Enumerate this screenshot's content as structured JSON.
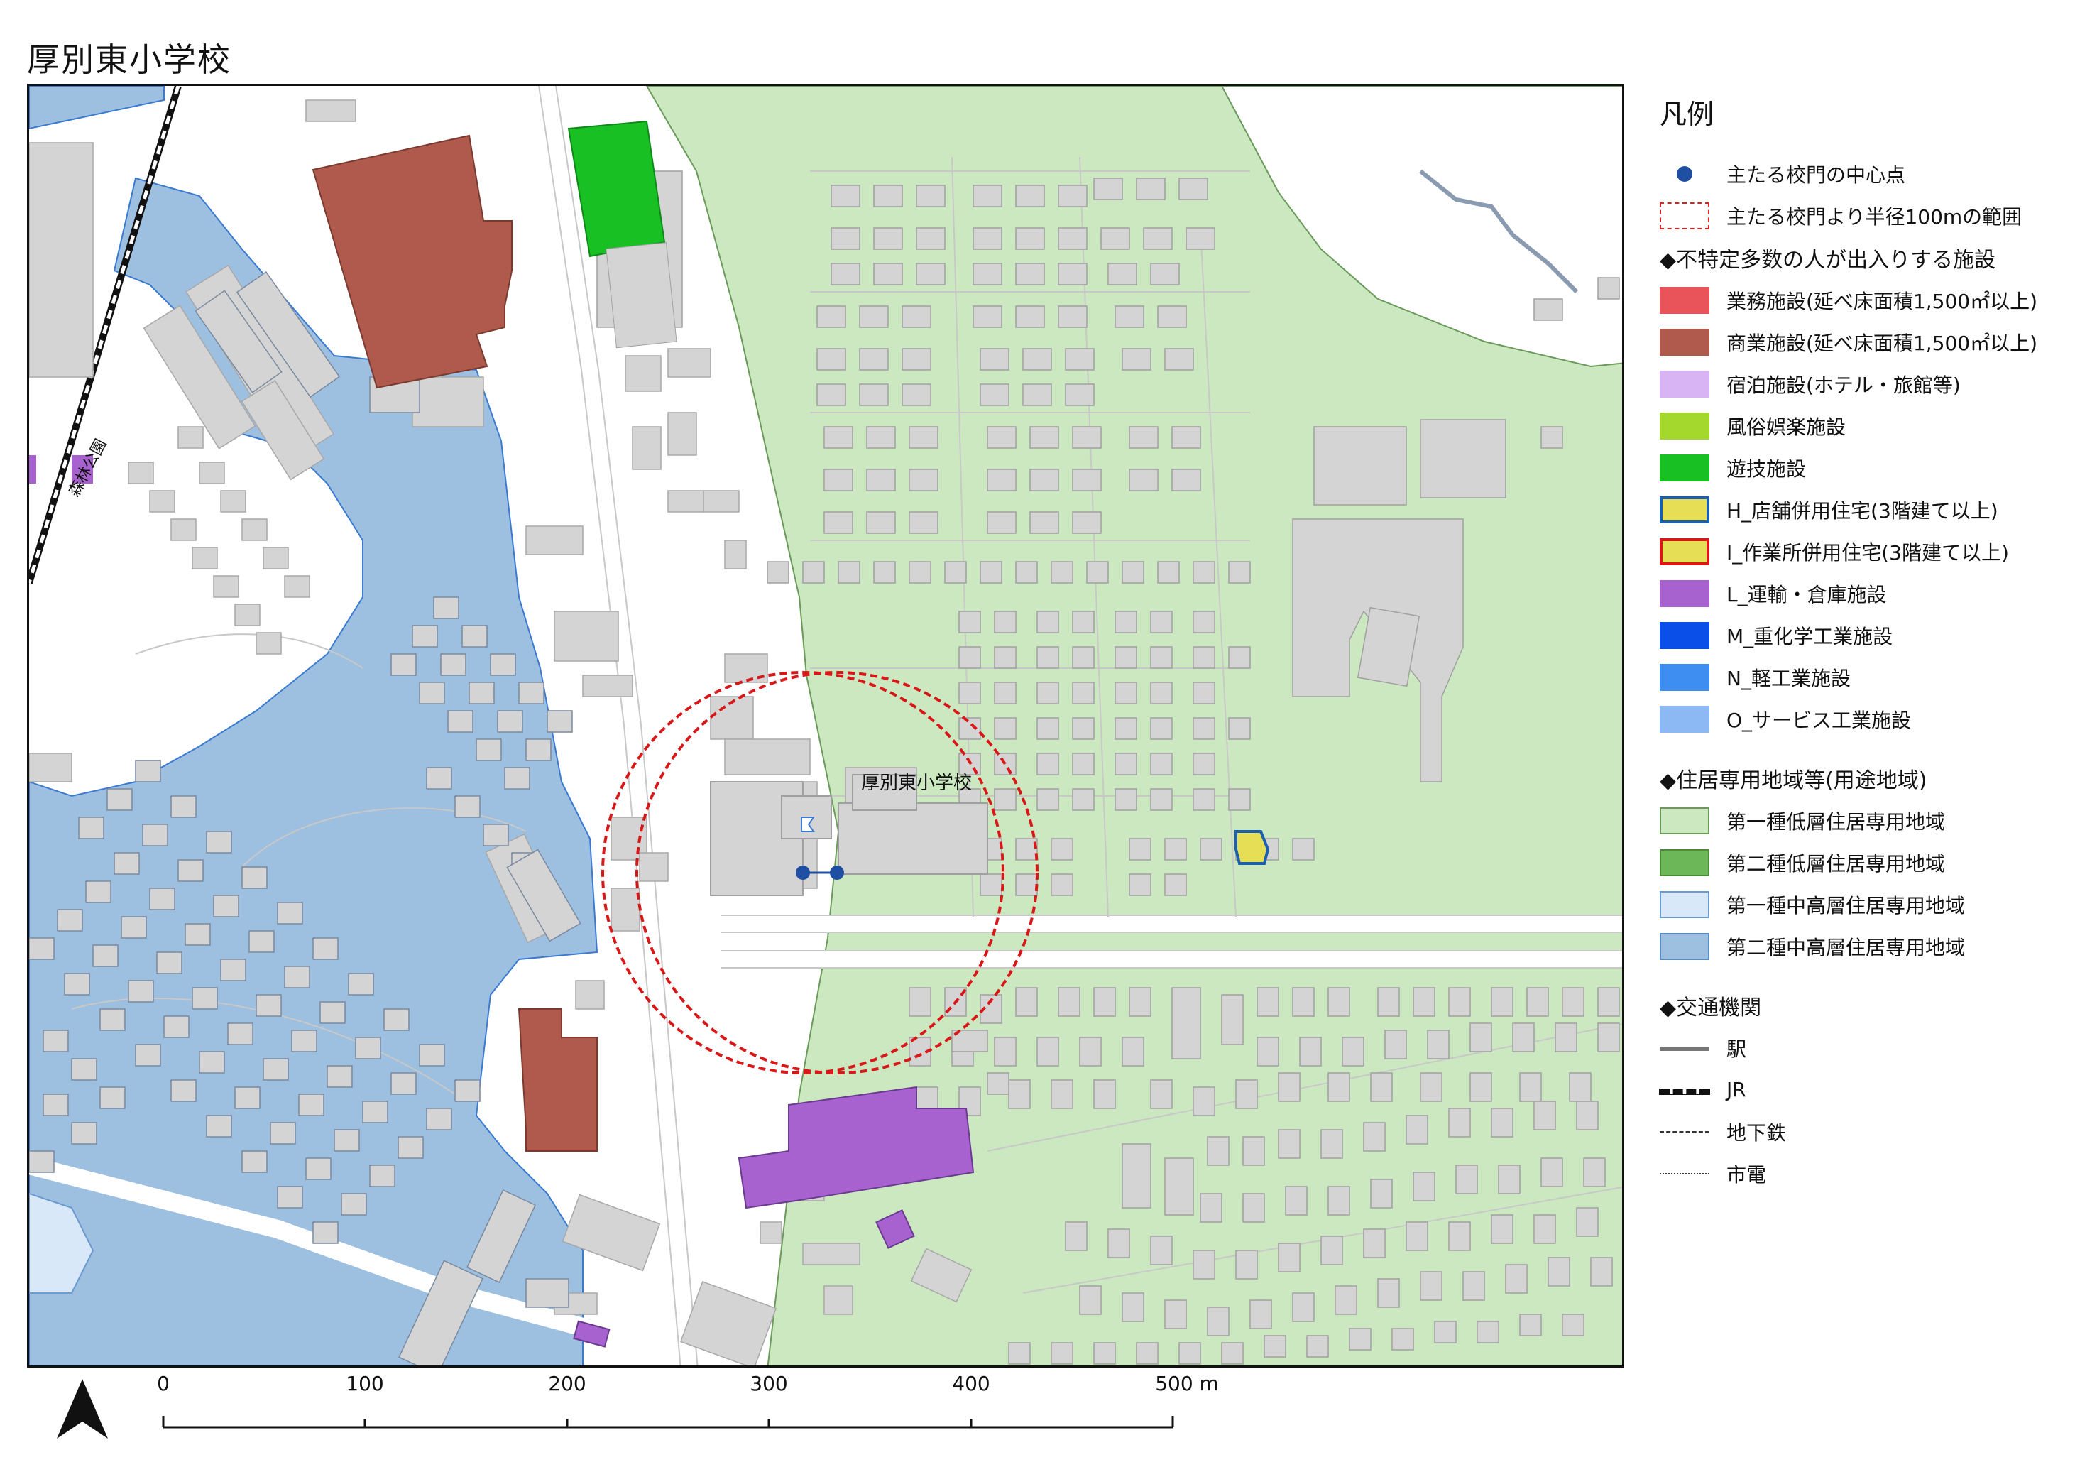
{
  "title": "厚別東小学校",
  "map": {
    "school_label": "厚別東小学校",
    "station_label": "森林公園",
    "colors": {
      "residential_low_1": "#cce8c0",
      "residential_midhigh_2": "#9dbfe0",
      "building": "#d4d4d4",
      "commercial": "#b05a4d",
      "amusement": "#18c024",
      "transport": "#a862d0",
      "shop_residence_fill": "#e6df55",
      "shop_residence_border": "#1b5fb0",
      "school_gate": "#1f4fa3",
      "radius_circle": "#d81818"
    }
  },
  "legend": {
    "title": "凡例",
    "gate_point": "主たる校門の中心点",
    "range_100m": "主たる校門より半径100mの範囲",
    "section_facilities": "◆不特定多数の人が出入りする施設",
    "facilities": [
      {
        "label": "業務施設(延べ床面積1,500㎡以上)",
        "color": "#e8545a"
      },
      {
        "label": "商業施設(延べ床面積1,500㎡以上)",
        "color": "#b05a4d"
      },
      {
        "label": "宿泊施設(ホテル・旅館等)",
        "color": "#d8b4f4"
      },
      {
        "label": "風俗娯楽施設",
        "color": "#a4d82c"
      },
      {
        "label": "遊技施設",
        "color": "#18c024"
      },
      {
        "label": "H_店舗併用住宅(3階建て以上)",
        "color": "#e6df55",
        "border": "#1b5fb0"
      },
      {
        "label": "I_作業所併用住宅(3階建て以上)",
        "color": "#e6df55",
        "border": "#d81818"
      },
      {
        "label": "L_運輸・倉庫施設",
        "color": "#a862d0"
      },
      {
        "label": "M_重化学工業施設",
        "color": "#0a4fe8"
      },
      {
        "label": "N_軽工業施設",
        "color": "#3d8ef0"
      },
      {
        "label": "O_サービス工業施設",
        "color": "#8cb8f4"
      }
    ],
    "section_residential": "◆住居専用地域等(用途地域)",
    "residential": [
      {
        "label": "第一種低層住居専用地域",
        "color": "#cce8c0",
        "border": "#6a9a5a"
      },
      {
        "label": "第二種低層住居専用地域",
        "color": "#6cb858",
        "border": "#4a8a3a"
      },
      {
        "label": "第一種中高層住居専用地域",
        "color": "#d8e8f8",
        "border": "#6a9ad0"
      },
      {
        "label": "第二種中高層住居専用地域",
        "color": "#9dbfe0",
        "border": "#5a8ac0"
      }
    ],
    "section_transport": "◆交通機関",
    "transport": [
      {
        "label": "駅",
        "style": "station"
      },
      {
        "label": "JR",
        "style": "jr"
      },
      {
        "label": "地下鉄",
        "style": "subway"
      },
      {
        "label": "市電",
        "style": "tram"
      }
    ]
  },
  "scale": {
    "ticks": [
      "0",
      "100",
      "200",
      "300",
      "400",
      "500 m"
    ]
  }
}
